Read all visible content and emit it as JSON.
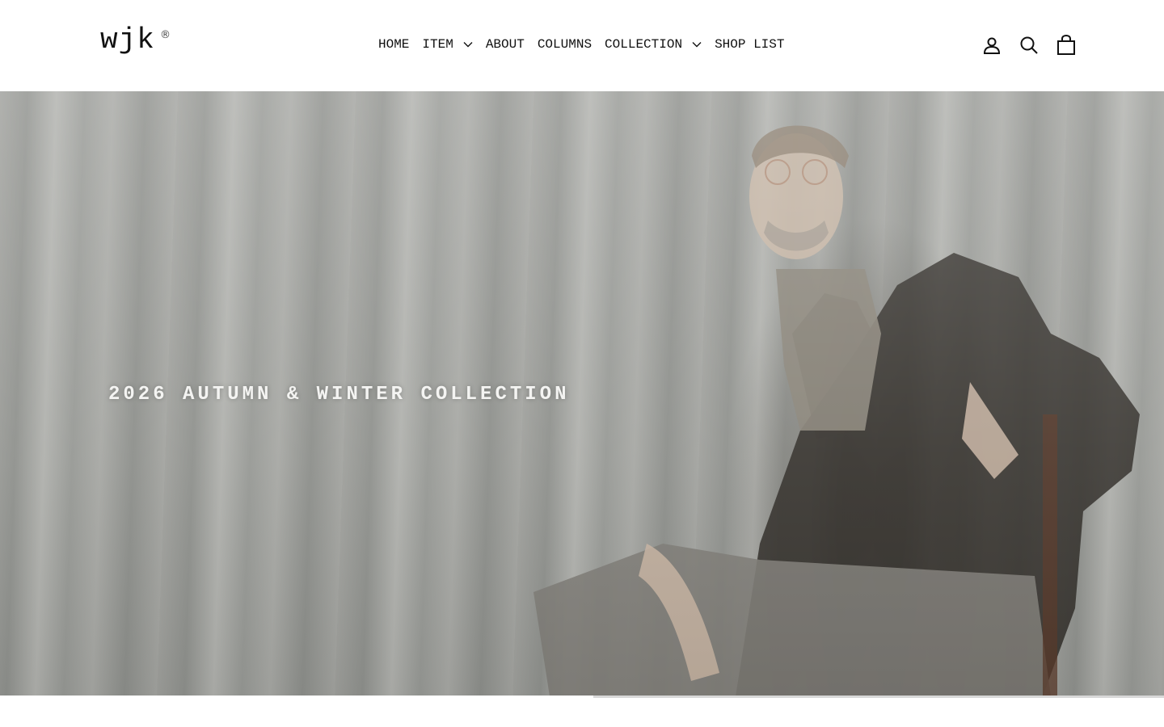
{
  "header": {
    "logo_text": "wjk",
    "logo_mark": "®",
    "nav": [
      {
        "label": "HOME",
        "has_dropdown": false
      },
      {
        "label": "ITEM",
        "has_dropdown": true
      },
      {
        "label": "ABOUT",
        "has_dropdown": false
      },
      {
        "label": "COLUMNS",
        "has_dropdown": false
      },
      {
        "label": "COLLECTION",
        "has_dropdown": true
      },
      {
        "label": "SHOP LIST",
        "has_dropdown": false
      }
    ],
    "actions": [
      {
        "name": "account-icon"
      },
      {
        "name": "search-icon"
      },
      {
        "name": "cart-icon"
      }
    ]
  },
  "hero": {
    "title": "2026 AUTUMN & WINTER COLLECTION",
    "slide_progress": 0.51
  },
  "colors": {
    "text": "#111111",
    "hero_text": "#f4f4f2",
    "background": "#ffffff"
  }
}
